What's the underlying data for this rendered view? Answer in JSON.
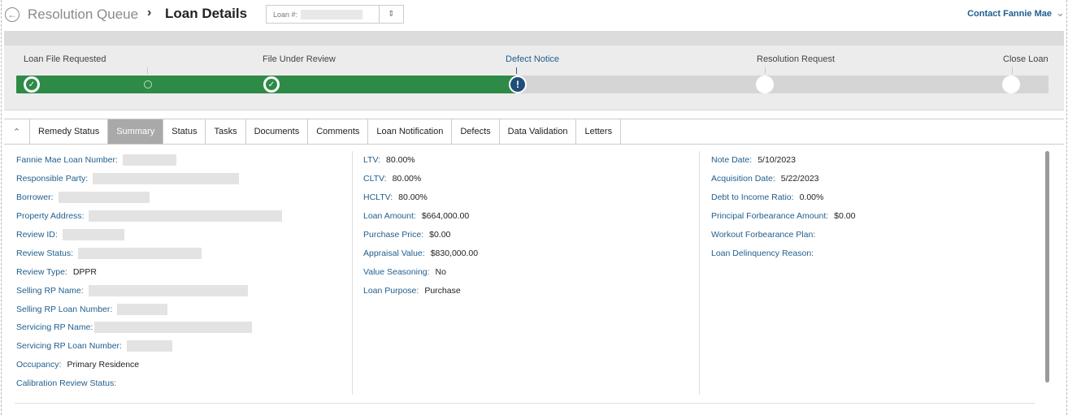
{
  "header": {
    "breadcrumb_parent": "Resolution Queue",
    "breadcrumb_separator": "›",
    "breadcrumb_current": "Loan Details",
    "loan_select_label": "Loan #:",
    "contact_link": "Contact Fannie Mae"
  },
  "progress": {
    "stages": [
      {
        "label": "Loan File Requested",
        "state": "complete"
      },
      {
        "label": "File Under Review",
        "state": "complete"
      },
      {
        "label": "Defect Notice",
        "state": "current"
      },
      {
        "label": "Resolution Request",
        "state": "pending"
      },
      {
        "label": "Close Loan",
        "state": "pending"
      }
    ],
    "complete_color": "#2e8b47",
    "current_color": "#1f4e79"
  },
  "tabs": [
    {
      "label": "Remedy Status",
      "active": false
    },
    {
      "label": "Summary",
      "active": true
    },
    {
      "label": "Status",
      "active": false
    },
    {
      "label": "Tasks",
      "active": false
    },
    {
      "label": "Documents",
      "active": false
    },
    {
      "label": "Comments",
      "active": false
    },
    {
      "label": "Loan Notification",
      "active": false
    },
    {
      "label": "Defects",
      "active": false
    },
    {
      "label": "Data Validation",
      "active": false
    },
    {
      "label": "Letters",
      "active": false
    }
  ],
  "summary": {
    "col1": [
      {
        "label": "Fannie Mae Loan Number:",
        "value": ""
      },
      {
        "label": "Responsible Party:",
        "value": ""
      },
      {
        "label": "Borrower:",
        "value": ""
      },
      {
        "label": "Property Address:",
        "value": ""
      },
      {
        "label": "Review ID:",
        "value": ""
      },
      {
        "label": "Review Status:",
        "value": ""
      },
      {
        "label": "Review Type:",
        "value": "DPPR"
      },
      {
        "label": "Selling RP Name:",
        "value": ""
      },
      {
        "label": "Selling RP Loan Number:",
        "value": ""
      },
      {
        "label": "Servicing RP Name:",
        "value": ""
      },
      {
        "label": "Servicing RP Loan Number:",
        "value": ""
      },
      {
        "label": "Occupancy:",
        "value": "Primary Residence"
      },
      {
        "label": "Calibration Review Status:",
        "value": ""
      }
    ],
    "col2": [
      {
        "label": "LTV:",
        "value": "80.00%"
      },
      {
        "label": "CLTV:",
        "value": "80.00%"
      },
      {
        "label": "HCLTV:",
        "value": "80.00%"
      },
      {
        "label": "Loan Amount:",
        "value": "$664,000.00"
      },
      {
        "label": "Purchase Price:",
        "value": "$0.00"
      },
      {
        "label": "Appraisal Value:",
        "value": "$830,000.00"
      },
      {
        "label": "Value Seasoning:",
        "value": "No"
      },
      {
        "label": "Loan Purpose:",
        "value": "Purchase"
      }
    ],
    "col3": [
      {
        "label": "Note Date:",
        "value": "5/10/2023"
      },
      {
        "label": "Acquisition Date:",
        "value": "5/22/2023"
      },
      {
        "label": "Debt to Income Ratio:",
        "value": "0.00%"
      },
      {
        "label": "Principal Forbearance Amount:",
        "value": "$0.00"
      },
      {
        "label": "Workout Forbearance Plan:",
        "value": ""
      },
      {
        "label": "Loan Delinquency Reason:",
        "value": ""
      }
    ]
  },
  "colors": {
    "label_blue": "#1f5e8e",
    "active_tab": "#a9a9a9"
  }
}
